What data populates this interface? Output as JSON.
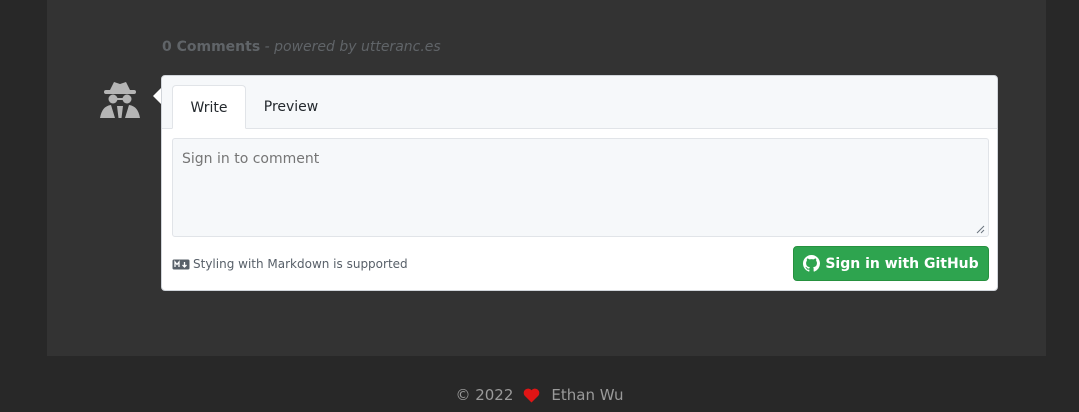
{
  "comments": {
    "count_label": "0 Comments",
    "powered_by": " - powered by utteranc.es"
  },
  "avatar": {
    "icon": "incognito-user-icon"
  },
  "editor": {
    "tabs": [
      {
        "label": "Write",
        "active": true
      },
      {
        "label": "Preview",
        "active": false
      }
    ],
    "textarea_placeholder": "Sign in to comment",
    "markdown_note": "Styling with Markdown is supported",
    "signin_button_label": "Sign in with GitHub",
    "signin_button_color": "#2ea44f"
  },
  "footer": {
    "copyright": "© 2022",
    "heart_color": "#e01515",
    "author": "Ethan Wu"
  }
}
